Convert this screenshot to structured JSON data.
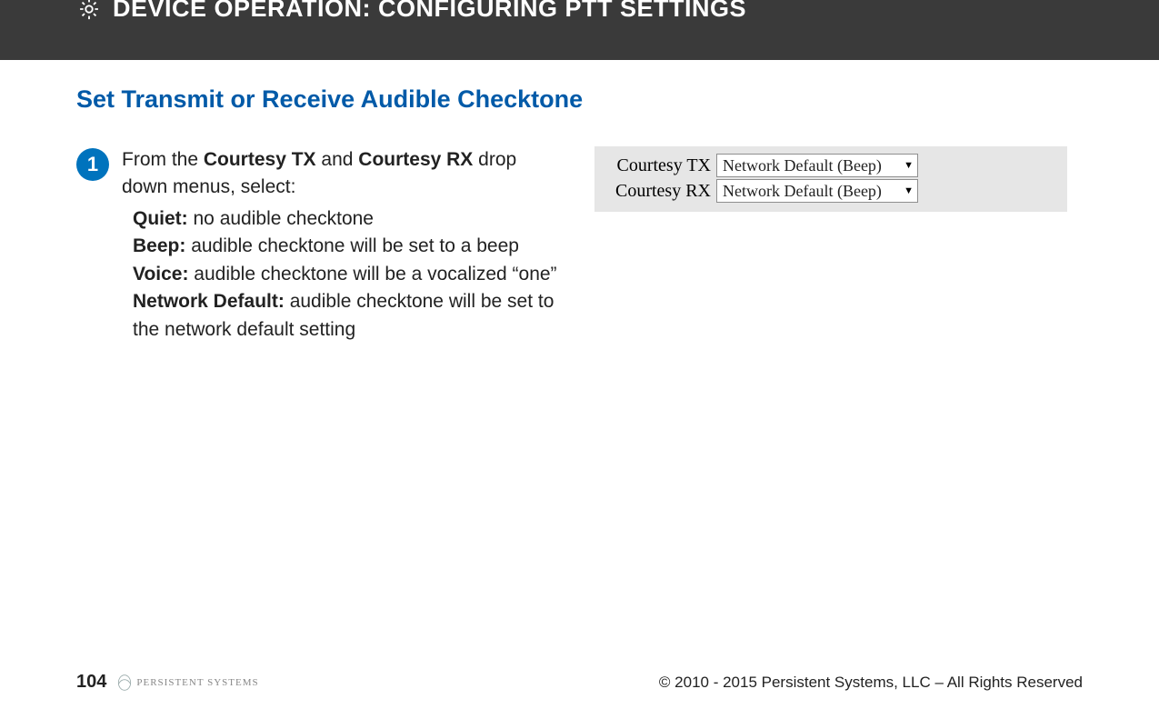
{
  "header": {
    "title": "DEVICE OPERATION:  CONFIGURING PTT SETTINGS"
  },
  "section": {
    "title": "Set Transmit or Receive Audible Checktone"
  },
  "step": {
    "number": "1",
    "lead_pre": "From the ",
    "lead_b1": "Courtesy TX",
    "lead_mid": " and ",
    "lead_b2": "Courtesy RX",
    "lead_post": " drop down menus, select:",
    "defs": [
      {
        "term": "Quiet:",
        "desc": "  no audible checktone"
      },
      {
        "term": "Beep:",
        "desc": "  audible checktone will be set to a beep"
      },
      {
        "term": "Voice:",
        "desc": "  audible checktone will be a vocalized “one”"
      },
      {
        "term": "Network Default:",
        "desc": "  audible checktone will be set to the network default setting"
      }
    ]
  },
  "panel": {
    "rows": [
      {
        "label": "Courtesy TX",
        "value": "Network Default (Beep)"
      },
      {
        "label": "Courtesy RX",
        "value": "Network Default (Beep)"
      }
    ]
  },
  "footer": {
    "page": "104",
    "logo_text": "PERSISTENT SYSTEMS",
    "copyright": "© 2010 - 2015 Persistent Systems, LLC – All Rights Reserved"
  }
}
